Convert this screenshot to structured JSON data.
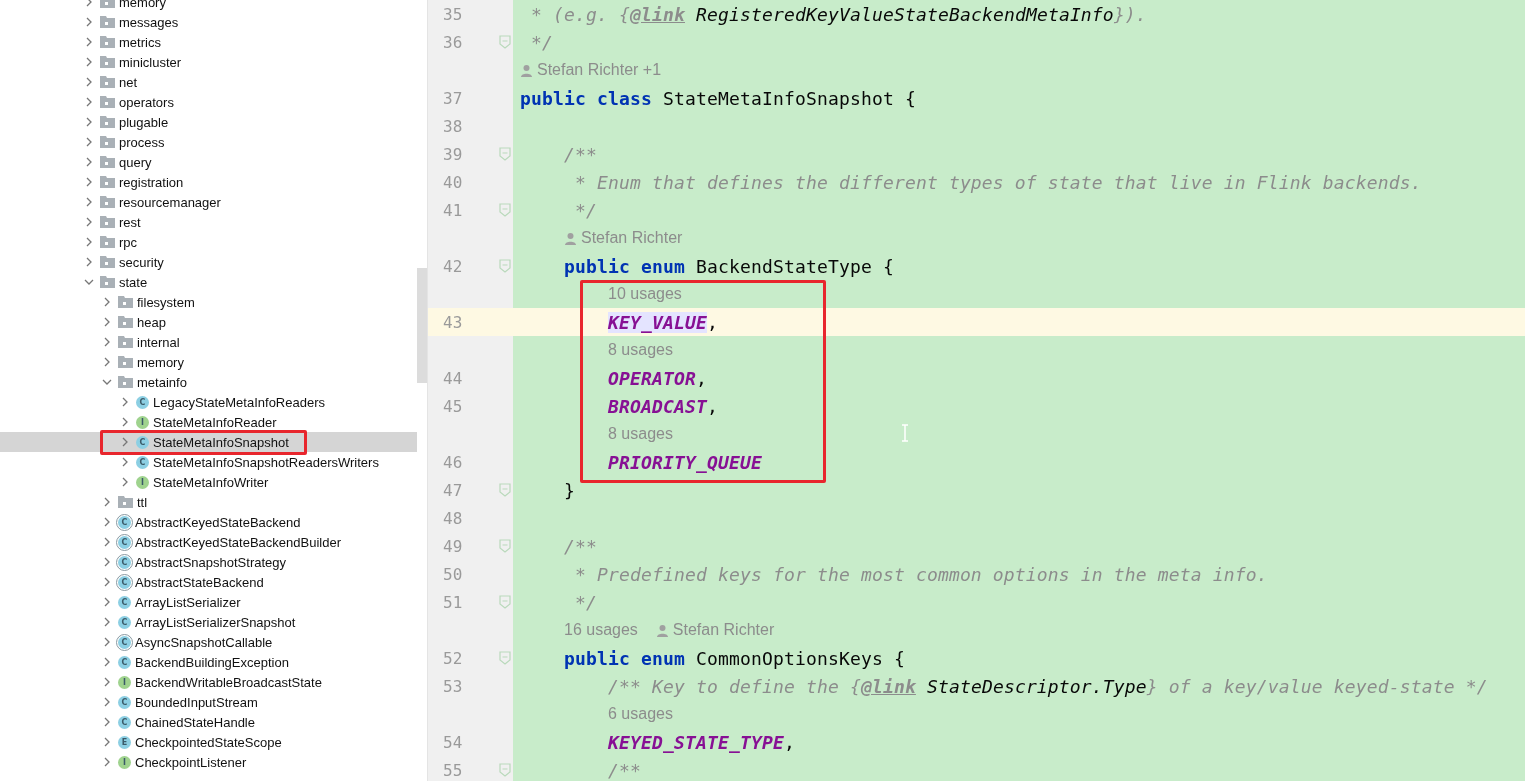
{
  "project_tree": {
    "items": [
      {
        "label": "memory",
        "kind": "folder",
        "expanded": false,
        "selected": false,
        "boxed": false
      },
      {
        "label": "messages",
        "kind": "folder",
        "expanded": false,
        "selected": false,
        "boxed": false
      },
      {
        "label": "metrics",
        "kind": "folder",
        "expanded": false,
        "selected": false,
        "boxed": false
      },
      {
        "label": "minicluster",
        "kind": "folder",
        "expanded": false,
        "selected": false,
        "boxed": false
      },
      {
        "label": "net",
        "kind": "folder",
        "expanded": false,
        "selected": false,
        "boxed": false
      },
      {
        "label": "operators",
        "kind": "folder",
        "expanded": false,
        "selected": false,
        "boxed": false
      },
      {
        "label": "plugable",
        "kind": "folder",
        "expanded": false,
        "selected": false,
        "boxed": false
      },
      {
        "label": "process",
        "kind": "folder",
        "expanded": false,
        "selected": false,
        "boxed": false
      },
      {
        "label": "query",
        "kind": "folder",
        "expanded": false,
        "selected": false,
        "boxed": false
      },
      {
        "label": "registration",
        "kind": "folder",
        "expanded": false,
        "selected": false,
        "boxed": false
      },
      {
        "label": "resourcemanager",
        "kind": "folder",
        "expanded": false,
        "selected": false,
        "boxed": false
      },
      {
        "label": "rest",
        "kind": "folder",
        "expanded": false,
        "selected": false,
        "boxed": false
      },
      {
        "label": "rpc",
        "kind": "folder",
        "expanded": false,
        "selected": false,
        "boxed": false
      },
      {
        "label": "security",
        "kind": "folder",
        "expanded": false,
        "selected": false,
        "boxed": false
      },
      {
        "label": "state",
        "kind": "folder",
        "expanded": true,
        "selected": false,
        "boxed": false,
        "children": [
          {
            "label": "filesystem",
            "kind": "folder",
            "expanded": false,
            "selected": false,
            "boxed": false
          },
          {
            "label": "heap",
            "kind": "folder",
            "expanded": false,
            "selected": false,
            "boxed": false
          },
          {
            "label": "internal",
            "kind": "folder",
            "expanded": false,
            "selected": false,
            "boxed": false
          },
          {
            "label": "memory",
            "kind": "folder",
            "expanded": false,
            "selected": false,
            "boxed": false
          },
          {
            "label": "metainfo",
            "kind": "folder",
            "expanded": true,
            "selected": false,
            "boxed": false,
            "children": [
              {
                "label": "LegacyStateMetaInfoReaders",
                "kind": "class",
                "badge": "C",
                "expanded": false,
                "selected": false,
                "boxed": false
              },
              {
                "label": "StateMetaInfoReader",
                "kind": "interface",
                "badge": "I",
                "expanded": false,
                "selected": false,
                "boxed": false
              },
              {
                "label": "StateMetaInfoSnapshot",
                "kind": "class",
                "badge": "C",
                "expanded": false,
                "selected": true,
                "boxed": true
              },
              {
                "label": "StateMetaInfoSnapshotReadersWriters",
                "kind": "class",
                "badge": "C",
                "expanded": false,
                "selected": false,
                "boxed": false
              },
              {
                "label": "StateMetaInfoWriter",
                "kind": "interface",
                "badge": "I",
                "expanded": false,
                "selected": false,
                "boxed": false
              }
            ]
          },
          {
            "label": "ttl",
            "kind": "folder",
            "expanded": false,
            "selected": false,
            "boxed": false
          },
          {
            "label": "AbstractKeyedStateBackend",
            "kind": "abstract",
            "badge": "C",
            "expanded": false,
            "selected": false,
            "boxed": false
          },
          {
            "label": "AbstractKeyedStateBackendBuilder",
            "kind": "abstract",
            "badge": "C",
            "expanded": false,
            "selected": false,
            "boxed": false
          },
          {
            "label": "AbstractSnapshotStrategy",
            "kind": "abstract",
            "badge": "C",
            "expanded": false,
            "selected": false,
            "boxed": false
          },
          {
            "label": "AbstractStateBackend",
            "kind": "abstract",
            "badge": "C",
            "expanded": false,
            "selected": false,
            "boxed": false
          },
          {
            "label": "ArrayListSerializer",
            "kind": "class",
            "badge": "C",
            "expanded": false,
            "selected": false,
            "boxed": false
          },
          {
            "label": "ArrayListSerializerSnapshot",
            "kind": "class",
            "badge": "C",
            "expanded": false,
            "selected": false,
            "boxed": false
          },
          {
            "label": "AsyncSnapshotCallable",
            "kind": "abstract",
            "badge": "C",
            "expanded": false,
            "selected": false,
            "boxed": false
          },
          {
            "label": "BackendBuildingException",
            "kind": "class",
            "badge": "C",
            "expanded": false,
            "selected": false,
            "boxed": false
          },
          {
            "label": "BackendWritableBroadcastState",
            "kind": "interface",
            "badge": "I",
            "expanded": false,
            "selected": false,
            "boxed": false
          },
          {
            "label": "BoundedInputStream",
            "kind": "class",
            "badge": "C",
            "expanded": false,
            "selected": false,
            "boxed": false
          },
          {
            "label": "ChainedStateHandle",
            "kind": "class",
            "badge": "C",
            "expanded": false,
            "selected": false,
            "boxed": false
          },
          {
            "label": "CheckpointedStateScope",
            "kind": "enum",
            "badge": "E",
            "expanded": false,
            "selected": false,
            "boxed": false
          },
          {
            "label": "CheckpointListener",
            "kind": "interface",
            "badge": "I",
            "expanded": false,
            "selected": false,
            "boxed": false
          }
        ]
      }
    ]
  },
  "editor": {
    "rows": [
      {
        "kind": "line",
        "number": "35",
        "fold": false,
        "current": false,
        "boxed": false,
        "tokens": [
          {
            "kind": "comment",
            "text": " * (e.g. {"
          },
          {
            "kind": "doctag",
            "text": "@link"
          },
          {
            "kind": "ref",
            "text": " RegisteredKeyValueStateBackendMetaInfo"
          },
          {
            "kind": "comment",
            "text": "})."
          }
        ]
      },
      {
        "kind": "line",
        "number": "36",
        "fold": true,
        "current": false,
        "boxed": false,
        "tokens": [
          {
            "kind": "comment",
            "text": " */"
          }
        ]
      },
      {
        "kind": "inlay",
        "boxed": false,
        "hints": [
          {
            "kind": "author",
            "text": "Stefan Richter +1"
          }
        ]
      },
      {
        "kind": "line",
        "number": "37",
        "fold": false,
        "current": false,
        "boxed": false,
        "tokens": [
          {
            "kind": "keyword",
            "text": "public class"
          },
          {
            "kind": "plain",
            "text": " StateMetaInfoSnapshot {"
          }
        ]
      },
      {
        "kind": "line",
        "number": "38",
        "fold": false,
        "current": false,
        "boxed": false,
        "tokens": []
      },
      {
        "kind": "line",
        "number": "39",
        "fold": true,
        "current": false,
        "boxed": false,
        "tokens": [
          {
            "kind": "comment",
            "text": "    /**"
          }
        ]
      },
      {
        "kind": "line",
        "number": "40",
        "fold": false,
        "current": false,
        "boxed": false,
        "tokens": [
          {
            "kind": "comment",
            "text": "     * Enum that defines the different types of state that live in Flink backends."
          }
        ]
      },
      {
        "kind": "line",
        "number": "41",
        "fold": true,
        "current": false,
        "boxed": false,
        "tokens": [
          {
            "kind": "comment",
            "text": "     */"
          }
        ]
      },
      {
        "kind": "inlay",
        "boxed": false,
        "hints": [
          {
            "kind": "author",
            "text": "Stefan Richter"
          }
        ]
      },
      {
        "kind": "line",
        "number": "42",
        "fold": true,
        "current": false,
        "boxed": false,
        "tokens": [
          {
            "kind": "keyword",
            "text": "    public enum"
          },
          {
            "kind": "plain",
            "text": " BackendStateType {"
          }
        ]
      },
      {
        "kind": "inlay",
        "boxed": true,
        "hints": [
          {
            "kind": "usages",
            "text": "10 usages"
          }
        ]
      },
      {
        "kind": "line",
        "number": "43",
        "fold": false,
        "current": true,
        "boxed": true,
        "tokens": [
          {
            "kind": "constant-highlighted",
            "text": "        KEY_VALUE"
          },
          {
            "kind": "plain",
            "text": ","
          }
        ]
      },
      {
        "kind": "inlay",
        "boxed": true,
        "hints": [
          {
            "kind": "usages",
            "text": "8 usages"
          }
        ]
      },
      {
        "kind": "line",
        "number": "44",
        "fold": false,
        "current": false,
        "boxed": true,
        "tokens": [
          {
            "kind": "constant",
            "text": "        OPERATOR"
          },
          {
            "kind": "plain",
            "text": ","
          }
        ]
      },
      {
        "kind": "line",
        "number": "45",
        "fold": false,
        "current": false,
        "boxed": true,
        "tokens": [
          {
            "kind": "constant",
            "text": "        BROADCAST"
          },
          {
            "kind": "plain",
            "text": ","
          }
        ]
      },
      {
        "kind": "inlay",
        "boxed": true,
        "hints": [
          {
            "kind": "usages",
            "text": "8 usages"
          }
        ]
      },
      {
        "kind": "line",
        "number": "46",
        "fold": false,
        "current": false,
        "boxed": true,
        "tokens": [
          {
            "kind": "constant",
            "text": "        PRIORITY_QUEUE"
          }
        ]
      },
      {
        "kind": "line",
        "number": "47",
        "fold": true,
        "current": false,
        "boxed": false,
        "tokens": [
          {
            "kind": "plain",
            "text": "    }"
          }
        ]
      },
      {
        "kind": "line",
        "number": "48",
        "fold": false,
        "current": false,
        "boxed": false,
        "tokens": []
      },
      {
        "kind": "line",
        "number": "49",
        "fold": true,
        "current": false,
        "boxed": false,
        "tokens": [
          {
            "kind": "comment",
            "text": "    /**"
          }
        ]
      },
      {
        "kind": "line",
        "number": "50",
        "fold": false,
        "current": false,
        "boxed": false,
        "tokens": [
          {
            "kind": "comment",
            "text": "     * Predefined keys for the most common options in the meta info."
          }
        ]
      },
      {
        "kind": "line",
        "number": "51",
        "fold": true,
        "current": false,
        "boxed": false,
        "tokens": [
          {
            "kind": "comment",
            "text": "     */"
          }
        ]
      },
      {
        "kind": "inlay",
        "boxed": false,
        "hints": [
          {
            "kind": "usages",
            "text": "16 usages"
          },
          {
            "kind": "author",
            "text": "Stefan Richter"
          }
        ]
      },
      {
        "kind": "line",
        "number": "52",
        "fold": true,
        "current": false,
        "boxed": false,
        "tokens": [
          {
            "kind": "keyword",
            "text": "    public enum"
          },
          {
            "kind": "plain",
            "text": " CommonOptionsKeys {"
          }
        ]
      },
      {
        "kind": "line",
        "number": "53",
        "fold": false,
        "current": false,
        "boxed": false,
        "tokens": [
          {
            "kind": "comment",
            "text": "        /** Key to define the {"
          },
          {
            "kind": "doctag",
            "text": "@link"
          },
          {
            "kind": "ref",
            "text": " StateDescriptor.Type"
          },
          {
            "kind": "comment",
            "text": "} of a key/value keyed-state */"
          }
        ]
      },
      {
        "kind": "inlay",
        "boxed": false,
        "hints": [
          {
            "kind": "usages",
            "text": "6 usages"
          }
        ]
      },
      {
        "kind": "line",
        "number": "54",
        "fold": false,
        "current": false,
        "boxed": false,
        "tokens": [
          {
            "kind": "constant",
            "text": "        KEYED_STATE_TYPE"
          },
          {
            "kind": "plain",
            "text": ","
          }
        ]
      },
      {
        "kind": "line",
        "number": "55",
        "fold": true,
        "current": false,
        "boxed": false,
        "tokens": [
          {
            "kind": "comment",
            "text": "        /**"
          }
        ]
      }
    ]
  }
}
